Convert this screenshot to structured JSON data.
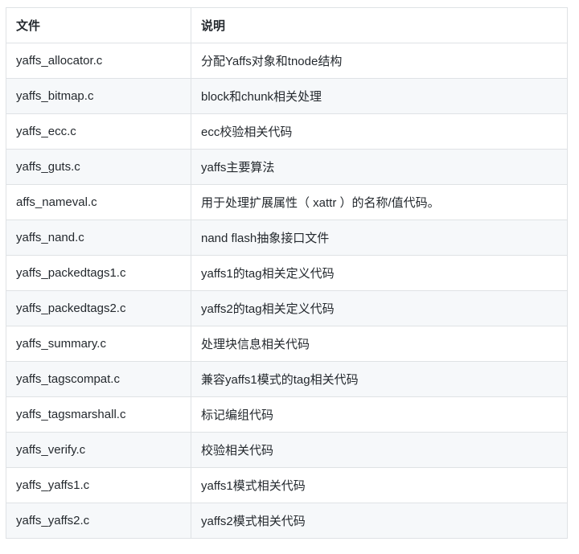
{
  "table": {
    "headers": [
      "文件",
      "说明"
    ],
    "rows": [
      [
        "yaffs_allocator.c",
        "分配Yaffs对象和tnode结构"
      ],
      [
        "yaffs_bitmap.c",
        "block和chunk相关处理"
      ],
      [
        "yaffs_ecc.c",
        "ecc校验相关代码"
      ],
      [
        "yaffs_guts.c",
        "yaffs主要算法"
      ],
      [
        "affs_nameval.c",
        "用于处理扩展属性（ xattr ）的名称/值代码。"
      ],
      [
        "yaffs_nand.c",
        "nand flash抽象接口文件"
      ],
      [
        "yaffs_packedtags1.c",
        "yaffs1的tag相关定义代码"
      ],
      [
        "yaffs_packedtags2.c",
        "yaffs2的tag相关定义代码"
      ],
      [
        "yaffs_summary.c",
        "处理块信息相关代码"
      ],
      [
        "yaffs_tagscompat.c",
        "兼容yaffs1模式的tag相关代码"
      ],
      [
        "yaffs_tagsmarshall.c",
        "标记编组代码"
      ],
      [
        "yaffs_verify.c",
        "校验相关代码"
      ],
      [
        "yaffs_yaffs1.c",
        "yaffs1模式相关代码"
      ],
      [
        "yaffs_yaffs2.c",
        "yaffs2模式相关代码"
      ]
    ]
  }
}
